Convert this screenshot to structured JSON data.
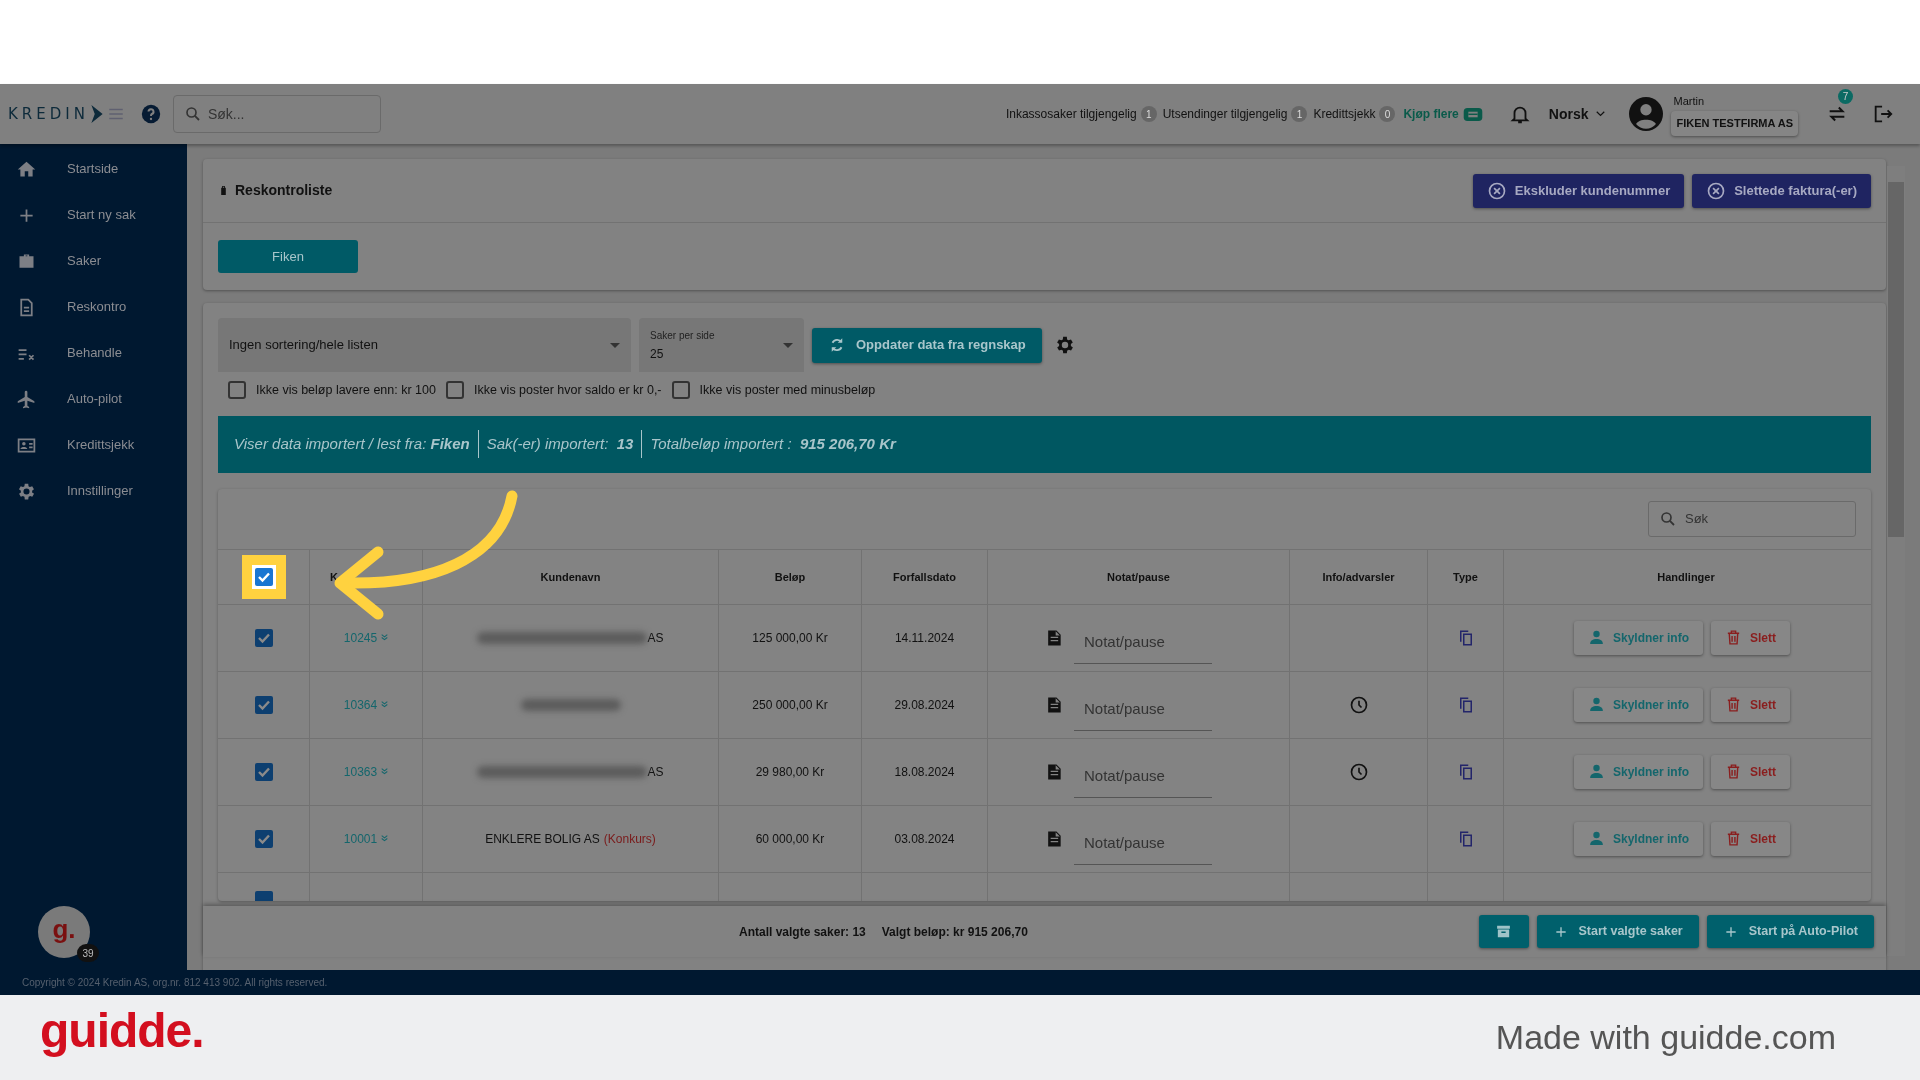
{
  "header": {
    "logo": "KREDIN",
    "search_placeholder": "Søk...",
    "counters": [
      {
        "label": "Inkassosaker tilgjengelig",
        "count": "1"
      },
      {
        "label": "Utsendinger tilgjengelig",
        "count": "1"
      },
      {
        "label": "Kredittsjekk",
        "count": "0"
      }
    ],
    "buy_more": "Kjøp flere",
    "language": "Norsk",
    "user_name": "Martin",
    "company": "FIKEN TESTFIRMA AS",
    "switch_badge": "7"
  },
  "sidebar": {
    "items": [
      {
        "label": "Startside"
      },
      {
        "label": "Start ny sak"
      },
      {
        "label": "Saker"
      },
      {
        "label": "Reskontro"
      },
      {
        "label": "Behandle"
      },
      {
        "label": "Auto-pilot"
      },
      {
        "label": "Kredittsjekk"
      },
      {
        "label": "Innstillinger"
      }
    ],
    "avatar": "g.",
    "avatar_badge": "39"
  },
  "page": {
    "title": "Reskontroliste",
    "buttons": [
      "Ekskluder kundenummer",
      "Slettede faktura(-er)"
    ],
    "tabs": [
      {
        "label": "Fiken",
        "selected": true
      }
    ]
  },
  "filters": {
    "sort": "Ingen sortering/hele listen",
    "per_page_label": "Saker per side",
    "per_page": "25",
    "update_button": "Oppdater data fra regnskap",
    "checkboxes": [
      {
        "label": "Ikke vis beløp lavere enn: kr 100",
        "checked": false
      },
      {
        "label": "Ikke vis poster hvor saldo er kr 0,-",
        "checked": false
      },
      {
        "label": "Ikke vis poster med minusbeløp",
        "checked": false
      }
    ]
  },
  "banner": [
    "Viser data importert / lest fra: **Fiken**",
    "Sak(-er) importert:  **13**",
    "Totalbeløp importert :  **915 206,70 Kr**"
  ],
  "table": {
    "search_placeholder": "Søk",
    "select_all_checked": true,
    "columns": [
      "K",
      "Kundenavn",
      "Beløp",
      "Forfallsdato",
      "Notat/pause",
      "Info/advarsler",
      "Type",
      "Handlinger"
    ],
    "rows": [
      {
        "checked": true,
        "number": "10245",
        "customer": "AS",
        "blurred": true,
        "amount": "125 000,00 Kr",
        "due": "14.11.2024",
        "note_placeholder": "Notat/pause",
        "warning": false,
        "actions": [
          "Skyldner info",
          "Slett"
        ]
      },
      {
        "checked": true,
        "number": "10364",
        "blurred": true,
        "amount": "250 000,00 Kr",
        "due": "29.08.2024",
        "note_placeholder": "Notat/pause",
        "warning": true,
        "actions": [
          "Skyldner info",
          "Slett"
        ]
      },
      {
        "checked": true,
        "number": "10363",
        "customer": "AS",
        "blurred": true,
        "amount": "29 980,00 Kr",
        "due": "18.08.2024",
        "note_placeholder": "Notat/pause",
        "warning": true,
        "actions": [
          "Skyldner info",
          "Slett"
        ]
      },
      {
        "checked": true,
        "number": "10001",
        "customer": "ENKLERE BOLIG AS",
        "status": "(Konkurs)",
        "blurred": false,
        "amount": "60 000,00 Kr",
        "due": "03.08.2024",
        "note_placeholder": "Notat/pause",
        "warning": false,
        "actions": [
          "Skyldner info",
          "Slett"
        ]
      },
      {
        "checked": true
      }
    ]
  },
  "bottom_bar": {
    "count": "Antall valgte saker: 13",
    "sum": "Valgt beløp: kr 915 206,70",
    "buttons": [
      "Start valgte saker",
      "Start på Auto-Pilot"
    ]
  },
  "copyright": "Copyright © 2024 Kredin AS, org.nr. 812 413 902. All rights reserved.",
  "branding": {
    "logo": "guidde.",
    "tagline": "Made with guidde.com"
  }
}
